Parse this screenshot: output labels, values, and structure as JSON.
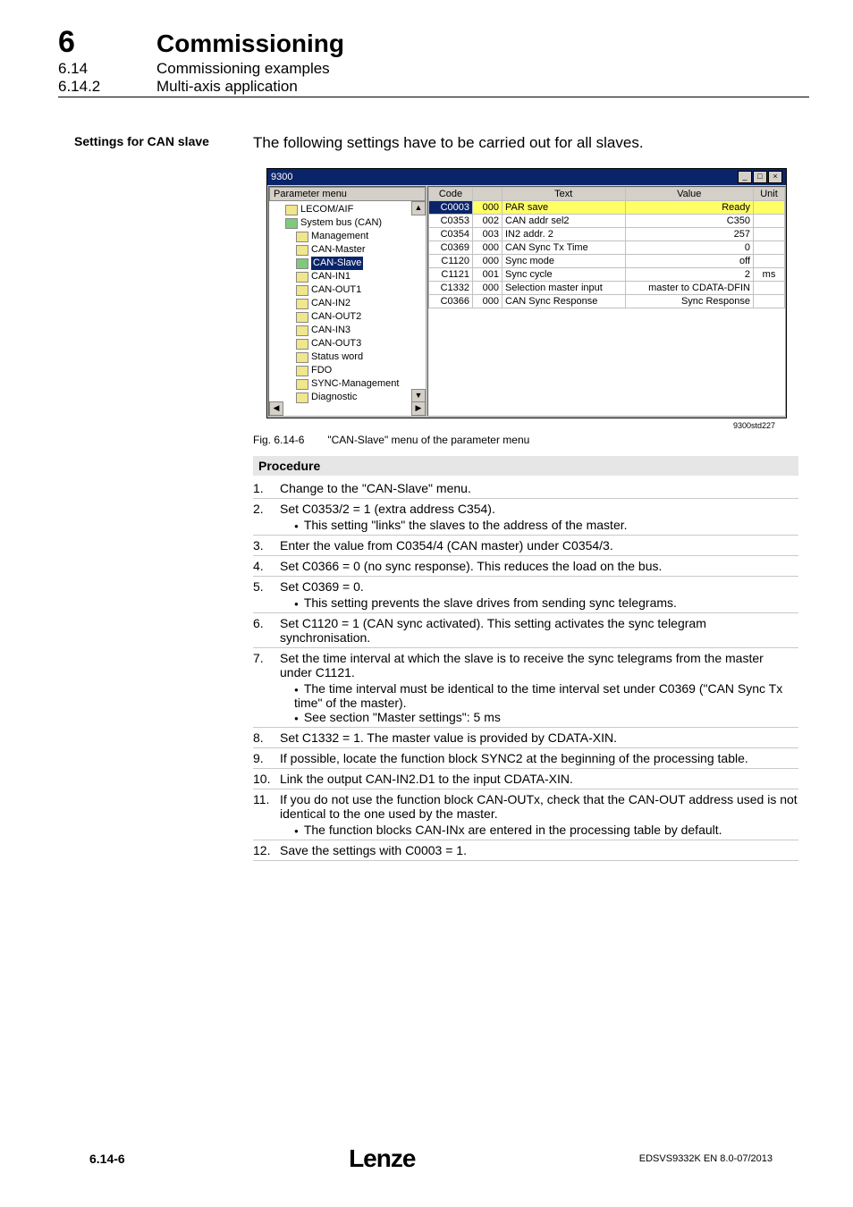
{
  "header": {
    "chapter_num": "6",
    "chapter_title": "Commissioning",
    "sub1_num": "6.14",
    "sub1_title": "Commissioning examples",
    "sub2_num": "6.14.2",
    "sub2_title": "Multi-axis application"
  },
  "side_heading": "Settings for CAN slave",
  "intro": "The following settings have to be carried out for all slaves.",
  "window": {
    "title": "9300",
    "tree_header": "Parameter menu",
    "tree": [
      {
        "label": "LECOM/AIF",
        "indent": 1,
        "sel": false,
        "open": false
      },
      {
        "label": "System bus (CAN)",
        "indent": 1,
        "sel": false,
        "open": true
      },
      {
        "label": "Management",
        "indent": 2,
        "sel": false,
        "open": false
      },
      {
        "label": "CAN-Master",
        "indent": 2,
        "sel": false,
        "open": false
      },
      {
        "label": "CAN-Slave",
        "indent": 2,
        "sel": true,
        "open": true
      },
      {
        "label": "CAN-IN1",
        "indent": 2,
        "sel": false,
        "open": false
      },
      {
        "label": "CAN-OUT1",
        "indent": 2,
        "sel": false,
        "open": false
      },
      {
        "label": "CAN-IN2",
        "indent": 2,
        "sel": false,
        "open": false
      },
      {
        "label": "CAN-OUT2",
        "indent": 2,
        "sel": false,
        "open": false
      },
      {
        "label": "CAN-IN3",
        "indent": 2,
        "sel": false,
        "open": false
      },
      {
        "label": "CAN-OUT3",
        "indent": 2,
        "sel": false,
        "open": false
      },
      {
        "label": "Status word",
        "indent": 2,
        "sel": false,
        "open": false
      },
      {
        "label": "FDO",
        "indent": 2,
        "sel": false,
        "open": false
      },
      {
        "label": "SYNC-Management",
        "indent": 2,
        "sel": false,
        "open": false
      },
      {
        "label": "Diagnostic",
        "indent": 2,
        "sel": false,
        "open": false
      }
    ],
    "grid_headers": {
      "code": "Code",
      "sub": "",
      "text": "Text",
      "value": "Value",
      "unit": "Unit"
    },
    "grid_rows": [
      {
        "code": "C0003",
        "sub": "000",
        "text": "PAR save",
        "value": "Ready",
        "unit": "",
        "hl": true
      },
      {
        "code": "C0353",
        "sub": "002",
        "text": "CAN addr sel2",
        "value": "C350",
        "unit": "",
        "hl": false
      },
      {
        "code": "C0354",
        "sub": "003",
        "text": "IN2 addr. 2",
        "value": "257",
        "unit": "",
        "hl": false
      },
      {
        "code": "C0369",
        "sub": "000",
        "text": "CAN Sync Tx Time",
        "value": "0",
        "unit": "",
        "hl": false
      },
      {
        "code": "C1120",
        "sub": "000",
        "text": "Sync mode",
        "value": "off",
        "unit": "",
        "hl": false
      },
      {
        "code": "C1121",
        "sub": "001",
        "text": "Sync cycle",
        "value": "2",
        "unit": "ms",
        "hl": false
      },
      {
        "code": "C1332",
        "sub": "000",
        "text": "Selection master input",
        "value": "master to CDATA-DFIN",
        "unit": "",
        "hl": false
      },
      {
        "code": "C0366",
        "sub": "000",
        "text": "CAN Sync Response",
        "value": "Sync Response",
        "unit": "",
        "hl": false
      }
    ]
  },
  "figure": {
    "id": "9300std227",
    "num": "Fig. 6.14-6",
    "caption": "\"CAN-Slave\" menu of the parameter menu"
  },
  "procedure": {
    "heading": "Procedure",
    "steps": [
      {
        "n": "1.",
        "text": "Change to the \"CAN-Slave\" menu.",
        "sub": []
      },
      {
        "n": "2.",
        "text": "Set C0353/2 = 1 (extra address C354).",
        "sub": [
          "This setting \"links\" the slaves to the address of the master."
        ]
      },
      {
        "n": "3.",
        "text": "Enter the value from C0354/4 (CAN master) under C0354/3.",
        "sub": []
      },
      {
        "n": "4.",
        "text": "Set C0366 = 0 (no sync response). This reduces the load on the bus.",
        "sub": []
      },
      {
        "n": "5.",
        "text": "Set C0369 = 0.",
        "sub": [
          "This setting prevents the slave drives from sending sync telegrams."
        ]
      },
      {
        "n": "6.",
        "text": "Set C1120 = 1 (CAN sync activated). This setting activates the sync telegram synchronisation.",
        "sub": []
      },
      {
        "n": "7.",
        "text": "Set the time interval at which the slave is to receive the sync telegrams from the master under C1121.",
        "sub": [
          "The time interval must be identical to the time interval set under C0369 (\"CAN Sync Tx time\" of the master).",
          "See section \"Master settings\": 5 ms"
        ]
      },
      {
        "n": "8.",
        "text": "Set C1332 = 1. The master value is provided by CDATA-XIN.",
        "sub": []
      },
      {
        "n": "9.",
        "text": "If possible, locate the function block SYNC2 at the beginning of the processing table.",
        "sub": []
      },
      {
        "n": "10.",
        "text": "Link the output CAN-IN2.D1 to the input CDATA-XIN.",
        "sub": []
      },
      {
        "n": "11.",
        "text": "If you do not use the function block CAN-OUTx, check that the CAN-OUT address used is not identical to the one used by the master.",
        "sub": [
          "The function blocks CAN-INx are entered in the processing table by default."
        ]
      },
      {
        "n": "12.",
        "text": "Save the settings with C0003 = 1.",
        "sub": []
      }
    ]
  },
  "footer": {
    "page": "6.14-6",
    "logo": "Lenze",
    "docid": "EDSVS9332K EN 8.0-07/2013"
  }
}
